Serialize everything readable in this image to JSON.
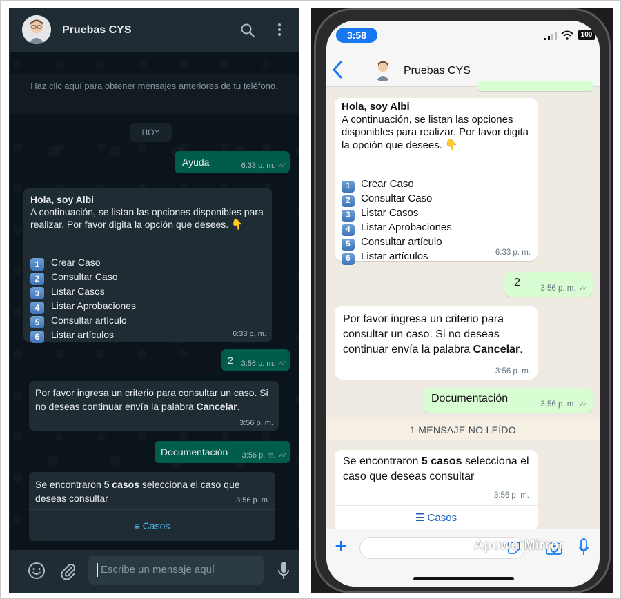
{
  "web": {
    "header_title": "Pruebas CYS",
    "older_messages": "Haz clic aquí para obtener mensajes anteriores de tu teléfono.",
    "day_label": "HOY",
    "msg_ayuda": {
      "text": "Ayuda",
      "time": "6:33 p. m."
    },
    "msg_menu": {
      "greeting": "Hola, soy Albi",
      "intro": "A continuación, se listan las opciones disponibles para realizar. Por favor digita la opción que desees. 👇",
      "options": [
        {
          "key": "1",
          "label": "Crear Caso"
        },
        {
          "key": "2",
          "label": "Consultar Caso"
        },
        {
          "key": "3",
          "label": "Listar Casos"
        },
        {
          "key": "4",
          "label": "Listar Aprobaciones"
        },
        {
          "key": "5",
          "label": "Consultar artículo"
        },
        {
          "key": "6",
          "label": "Listar artículos"
        }
      ],
      "time": "6:33 p. m."
    },
    "msg_two": {
      "text": "2",
      "time": "3:56 p. m."
    },
    "msg_criterio": {
      "text_a": "Por favor ingresa un criterio para consultar un caso. Si no deseas continuar envía la palabra ",
      "text_bold": "Cancelar",
      "text_end": ".",
      "time": "3:56 p. m."
    },
    "msg_doc": {
      "text": "Documentación",
      "time": "3:56 p. m."
    },
    "msg_found": {
      "text_a": "Se encontraron ",
      "text_bold": "5 casos",
      "text_b": " selecciona el caso que deseas consultar",
      "time": "3:56 p. m.",
      "button": "Casos"
    },
    "input_placeholder": "Escribe un mensaje aquí"
  },
  "phone": {
    "status_time": "3:58",
    "battery": "100",
    "header_title": "Pruebas CYS",
    "msg_menu": {
      "greeting": "Hola, soy Albi",
      "intro": "A continuación, se listan las opciones disponibles para realizar. Por favor digita la opción que desees. 👇",
      "options": [
        {
          "key": "1",
          "label": "Crear Caso"
        },
        {
          "key": "2",
          "label": "Consultar Caso"
        },
        {
          "key": "3",
          "label": "Listar Casos"
        },
        {
          "key": "4",
          "label": "Listar Aprobaciones"
        },
        {
          "key": "5",
          "label": "Consultar artículo"
        },
        {
          "key": "6",
          "label": "Listar artículos"
        }
      ],
      "time": "6:33 p. m."
    },
    "msg_two": {
      "text": "2",
      "time": "3:56 p. m."
    },
    "msg_criterio": {
      "text_a": "Por favor ingresa un criterio para consultar un caso. Si no deseas continuar envía la palabra ",
      "text_bold": "Cancelar",
      "text_end": ".",
      "time": "3:56 p. m."
    },
    "msg_doc": {
      "text": "Documentación",
      "time": "3:56 p. m."
    },
    "unread_banner": "1 MENSAJE NO LEÍDO",
    "msg_found": {
      "text_a": "Se encontraron ",
      "text_bold": "5 casos",
      "text_b": " selecciona el caso que deseas consultar",
      "time": "3:56 p. m.",
      "button": "Casos"
    },
    "watermark": "ApowerMirror"
  },
  "colors": {
    "web_bg": "#0b141a",
    "web_header": "#202c33",
    "web_outgoing": "#005c4b",
    "web_incoming": "#202c33",
    "phone_outgoing": "#d9fdd3",
    "phone_incoming": "#ffffff",
    "ios_blue": "#1778f2"
  }
}
